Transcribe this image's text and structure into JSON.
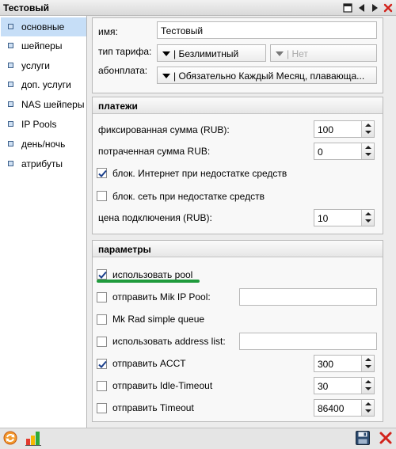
{
  "window": {
    "title": "Тестовый"
  },
  "sidebar": {
    "items": [
      {
        "label": "основные",
        "active": true
      },
      {
        "label": "шейперы"
      },
      {
        "label": "услуги"
      },
      {
        "label": "доп. услуги"
      },
      {
        "label": "NAS шейперы"
      },
      {
        "label": "IP Pools"
      },
      {
        "label": "день/ночь"
      },
      {
        "label": "атрибуты"
      }
    ]
  },
  "general": {
    "name_label": "имя:",
    "name_value": "Тестовый",
    "tariff_type_label": "тип тарифа:",
    "tariff_type_value": "| Безлимитный",
    "tariff_sub_value": "| Нет",
    "fee_label": "абонплата:",
    "fee_value": "| Обязательно Каждый Месяц, плавающа..."
  },
  "payments": {
    "title": "платежи",
    "fixed_sum_label": "фиксированная сумма (RUB):",
    "fixed_sum_value": "100",
    "spent_sum_label": "потраченная сумма RUB:",
    "spent_sum_value": "0",
    "block_internet_label": "блок. Интернет при недостатке средств",
    "block_internet_checked": true,
    "block_network_label": "блок. сеть при недостатке средств",
    "block_network_checked": false,
    "connection_price_label": "цена подключения (RUB):",
    "connection_price_value": "10"
  },
  "params": {
    "title": "параметры",
    "use_pool_label": "использовать pool",
    "use_pool_checked": true,
    "send_mik_pool_label": "отправить Mik IP Pool:",
    "send_mik_pool_checked": false,
    "mk_rad_label": "Mk Rad simple queue",
    "mk_rad_checked": false,
    "use_address_list_label": "использовать address list:",
    "use_address_list_checked": false,
    "send_acct_label": "отправить ACCT",
    "send_acct_checked": true,
    "send_acct_value": "300",
    "send_idle_label": "отправить Idle-Timeout",
    "send_idle_checked": false,
    "send_idle_value": "30",
    "send_timeout_label": "отправить Timeout",
    "send_timeout_checked": false,
    "send_timeout_value": "86400"
  },
  "icons": {
    "title_controls": [
      "maximize-icon",
      "previous-icon",
      "next-icon",
      "close-icon"
    ],
    "bottom_left": [
      "refresh-icon",
      "chart-icon"
    ],
    "bottom_right": [
      "save-icon",
      "delete-icon"
    ]
  },
  "colors": {
    "active_item": "#c6def7",
    "highlight_underline": "#1f9a3c",
    "close_red": "#d2231c",
    "refresh_orange": "#e8771c"
  }
}
